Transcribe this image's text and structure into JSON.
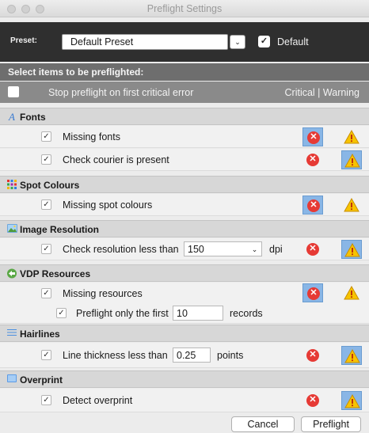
{
  "window": {
    "title": "Preflight Settings"
  },
  "preset": {
    "label": "Preset:",
    "value": "Default Preset",
    "default_label": "Default",
    "default_checked": true
  },
  "select_header": "Select items to be preflighted:",
  "stop_row": {
    "label": "Stop preflight on first critical error",
    "columns_label": "Critical | Warning"
  },
  "categories": [
    {
      "label": "Fonts",
      "icon": "font-icon",
      "items": [
        {
          "label": "Missing fonts",
          "checked": true,
          "critical_selected": true,
          "warning_selected": false
        },
        {
          "label": "Check courier is present",
          "checked": true,
          "critical_selected": false,
          "warning_selected": true
        }
      ]
    },
    {
      "label": "Spot Colours",
      "icon": "spot-colours-icon",
      "items": [
        {
          "label": "Missing spot colours",
          "checked": true,
          "critical_selected": true,
          "warning_selected": false
        }
      ]
    },
    {
      "label": "Image Resolution",
      "icon": "image-icon",
      "items": [
        {
          "label": "Check resolution less than",
          "value": "150",
          "unit": "dpi",
          "checked": true,
          "critical_selected": false,
          "warning_selected": true
        }
      ]
    },
    {
      "label": "VDP Resources",
      "icon": "vdp-icon",
      "items": [
        {
          "label": "Missing resources",
          "checked": true,
          "critical_selected": true,
          "warning_selected": false
        },
        {
          "label": "Preflight only the first",
          "value": "10",
          "unit": "records",
          "checked": true
        }
      ]
    },
    {
      "label": "Hairlines",
      "icon": "hairlines-icon",
      "items": [
        {
          "label": "Line thickness less than",
          "value": "0.25",
          "unit": "points",
          "checked": true,
          "critical_selected": false,
          "warning_selected": true
        }
      ]
    },
    {
      "label": "Overprint",
      "icon": "overprint-icon",
      "items": [
        {
          "label": "Detect overprint",
          "checked": true,
          "critical_selected": false,
          "warning_selected": true
        }
      ]
    }
  ],
  "buttons": {
    "cancel": "Cancel",
    "preflight": "Preflight"
  },
  "colors": {
    "critical": "#e63a35",
    "warning": "#f7c300",
    "selection": "#89b6e6",
    "preset_bar": "#2f2f2f"
  }
}
